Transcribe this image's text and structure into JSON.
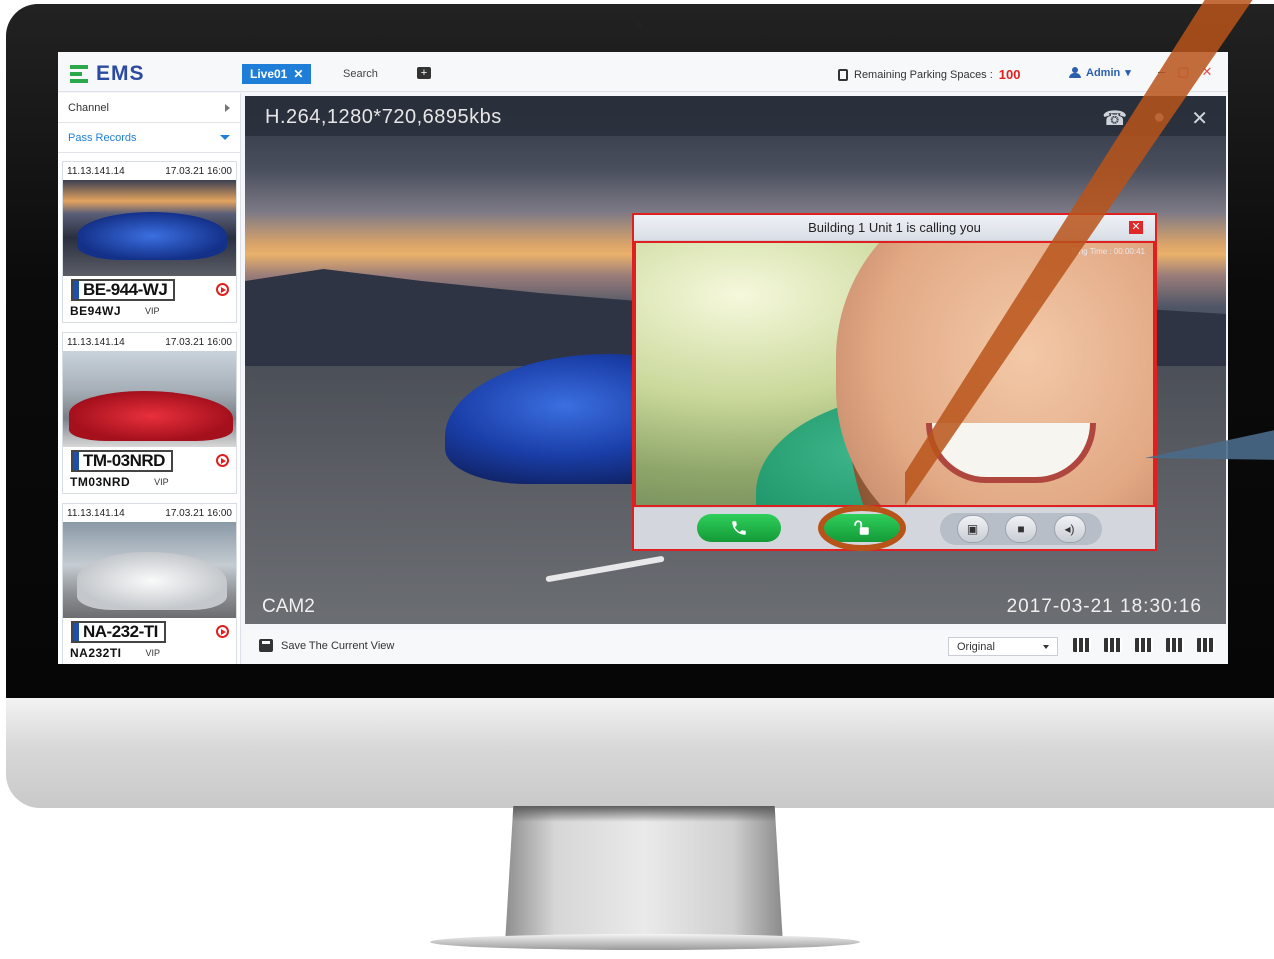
{
  "app": {
    "name": "EMS"
  },
  "tabs": [
    {
      "label": "Live01"
    },
    {
      "label": "Search"
    }
  ],
  "header": {
    "parking_label": "Remaining Parking Spaces :",
    "parking_count": "100",
    "user": "Admin"
  },
  "sidebar": {
    "channel_label": "Channel",
    "pass_records_label": "Pass Records",
    "records": [
      {
        "ip": "11.13.141.14",
        "time": "17.03.21 16:00",
        "plate_image": "BE-944-WJ",
        "plate": "BE94WJ",
        "tag": "VIP"
      },
      {
        "ip": "11.13.141.14",
        "time": "17.03.21 16:00",
        "plate_image": "TM-03NRD",
        "plate": "TM03NRD",
        "tag": "VIP"
      },
      {
        "ip": "11.13.141.14",
        "time": "17.03.21 16:00",
        "plate_image": "NA-232-TI",
        "plate": "NA232TI",
        "tag": "VIP"
      }
    ]
  },
  "video": {
    "info": "H.264,1280*720,6895kbs",
    "camera": "CAM2",
    "timestamp": "2017-03-21 18:30:16"
  },
  "call": {
    "title": "Building 1 Unit 1 is calling you",
    "ring_time": "Ring Time : 00:00:41"
  },
  "bottom": {
    "save_label": "Save The Current View",
    "view_option": "Original"
  },
  "colors": {
    "accent": "#1f7fd8",
    "alert": "#e02020",
    "call_green": "#1fb547",
    "highlight": "#b8541a"
  }
}
